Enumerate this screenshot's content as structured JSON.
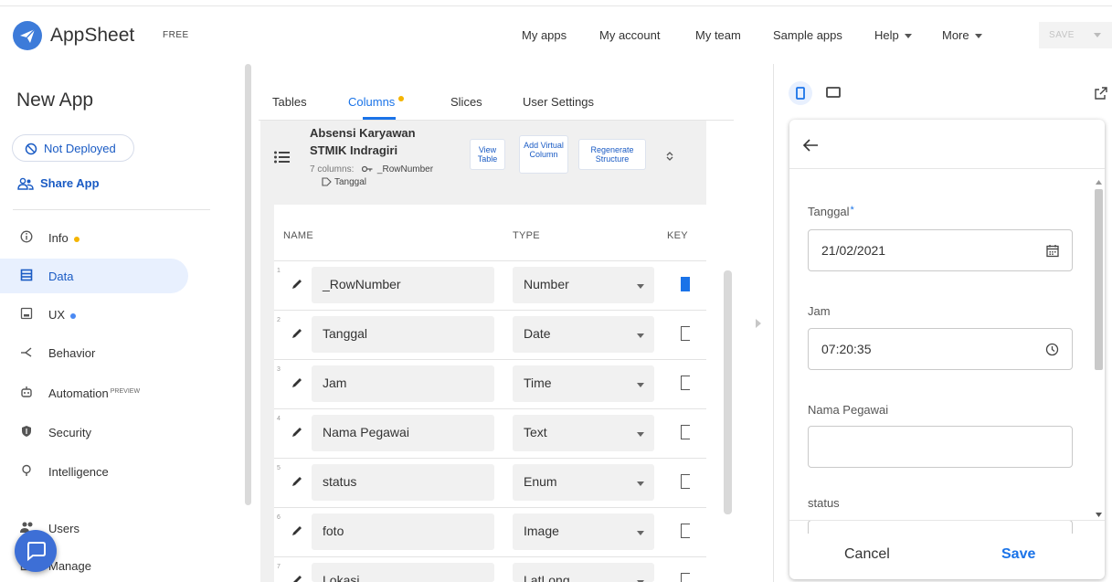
{
  "header": {
    "brand": "AppSheet",
    "plan": "FREE",
    "nav": [
      "My apps",
      "My account",
      "My team",
      "Sample apps",
      "Help",
      "More"
    ],
    "save_label": "SAVE"
  },
  "sidebar": {
    "app_name": "New App",
    "deploy_status": "Not Deployed",
    "share_label": "Share App",
    "items": [
      {
        "label": "Info",
        "dot": "#f4b400",
        "icon": "info-icon"
      },
      {
        "label": "Data",
        "active": true,
        "icon": "table-icon"
      },
      {
        "label": "UX",
        "dot": "#4a89f3",
        "icon": "ux-icon"
      },
      {
        "label": "Behavior",
        "icon": "behavior-icon"
      },
      {
        "label": "Automation",
        "badge": "PREVIEW",
        "icon": "robot-icon"
      },
      {
        "label": "Security",
        "icon": "shield-icon"
      },
      {
        "label": "Intelligence",
        "icon": "bulb-icon"
      },
      {
        "label": "Users",
        "icon": "users-icon"
      },
      {
        "label": "Manage",
        "icon": "manage-icon"
      }
    ]
  },
  "tabs": [
    {
      "label": "Tables"
    },
    {
      "label": "Columns",
      "active": true,
      "dot": "#f4b400"
    },
    {
      "label": "Slices"
    },
    {
      "label": "User Settings"
    }
  ],
  "table": {
    "title": "Absensi Karyawan STMIK Indragiri",
    "meta": "7 columns:",
    "key_column": "_RowNumber",
    "label_column": "Tanggal",
    "buttons": {
      "view": "View Table",
      "add_virtual": "Add Virtual Column",
      "regenerate": "Regenerate Structure"
    }
  },
  "columns": {
    "headers": [
      "NAME",
      "TYPE",
      "KEY"
    ],
    "rows": [
      {
        "num": "1",
        "name": "_RowNumber",
        "type": "Number",
        "key": true
      },
      {
        "num": "2",
        "name": "Tanggal",
        "type": "Date",
        "key": false
      },
      {
        "num": "3",
        "name": "Jam",
        "type": "Time",
        "key": false
      },
      {
        "num": "4",
        "name": "Nama Pegawai",
        "type": "Text",
        "key": false
      },
      {
        "num": "5",
        "name": "status",
        "type": "Enum",
        "key": false
      },
      {
        "num": "6",
        "name": "foto",
        "type": "Image",
        "key": false
      },
      {
        "num": "7",
        "name": "Lokasi",
        "type": "LatLong",
        "key": false
      }
    ]
  },
  "preview": {
    "fields": [
      {
        "label": "Tanggal",
        "required": true,
        "value": "21/02/2021",
        "icon": "calendar-icon"
      },
      {
        "label": "Jam",
        "value": "07:20:35",
        "icon": "clock-icon"
      },
      {
        "label": "Nama Pegawai",
        "value": ""
      },
      {
        "label": "status",
        "value": ""
      }
    ],
    "cancel_label": "Cancel",
    "save_label": "Save"
  },
  "colors": {
    "accent": "#1a73e8",
    "brand_blue": "#3d7bd9",
    "active_bg": "#e8f0fe"
  }
}
